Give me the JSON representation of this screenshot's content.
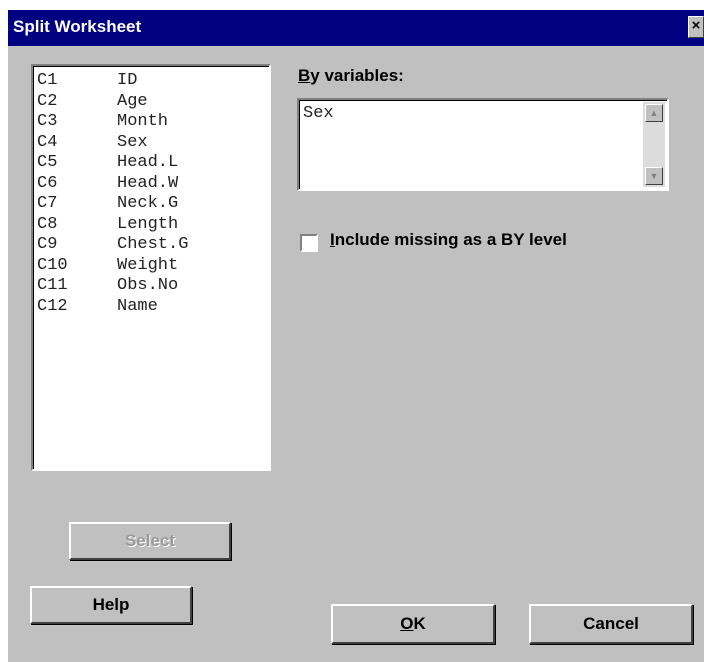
{
  "window": {
    "title": "Split Worksheet",
    "close_glyph": "×"
  },
  "columns": [
    {
      "col": "C1",
      "name": "ID"
    },
    {
      "col": "C2",
      "name": "Age"
    },
    {
      "col": "C3",
      "name": "Month"
    },
    {
      "col": "C4",
      "name": "Sex"
    },
    {
      "col": "C5",
      "name": "Head.L"
    },
    {
      "col": "C6",
      "name": "Head.W"
    },
    {
      "col": "C7",
      "name": "Neck.G"
    },
    {
      "col": "C8",
      "name": "Length"
    },
    {
      "col": "C9",
      "name": "Chest.G"
    },
    {
      "col": "C10",
      "name": "Weight"
    },
    {
      "col": "C11",
      "name": "Obs.No"
    },
    {
      "col": "C12",
      "name": "Name"
    }
  ],
  "by_variables": {
    "label_mnemonic": "B",
    "label_rest": "y variables:",
    "value": "Sex"
  },
  "include_missing": {
    "mnemonic": "I",
    "label_rest": "nclude missing as a BY level",
    "checked": false
  },
  "buttons": {
    "select": "Select",
    "help": "Help",
    "ok_mnemonic": "O",
    "ok_rest": "K",
    "cancel": "Cancel"
  },
  "icons": {
    "scroll_up": "scroll-up-arrow-icon",
    "scroll_down": "scroll-down-arrow-icon",
    "close": "close-icon"
  }
}
